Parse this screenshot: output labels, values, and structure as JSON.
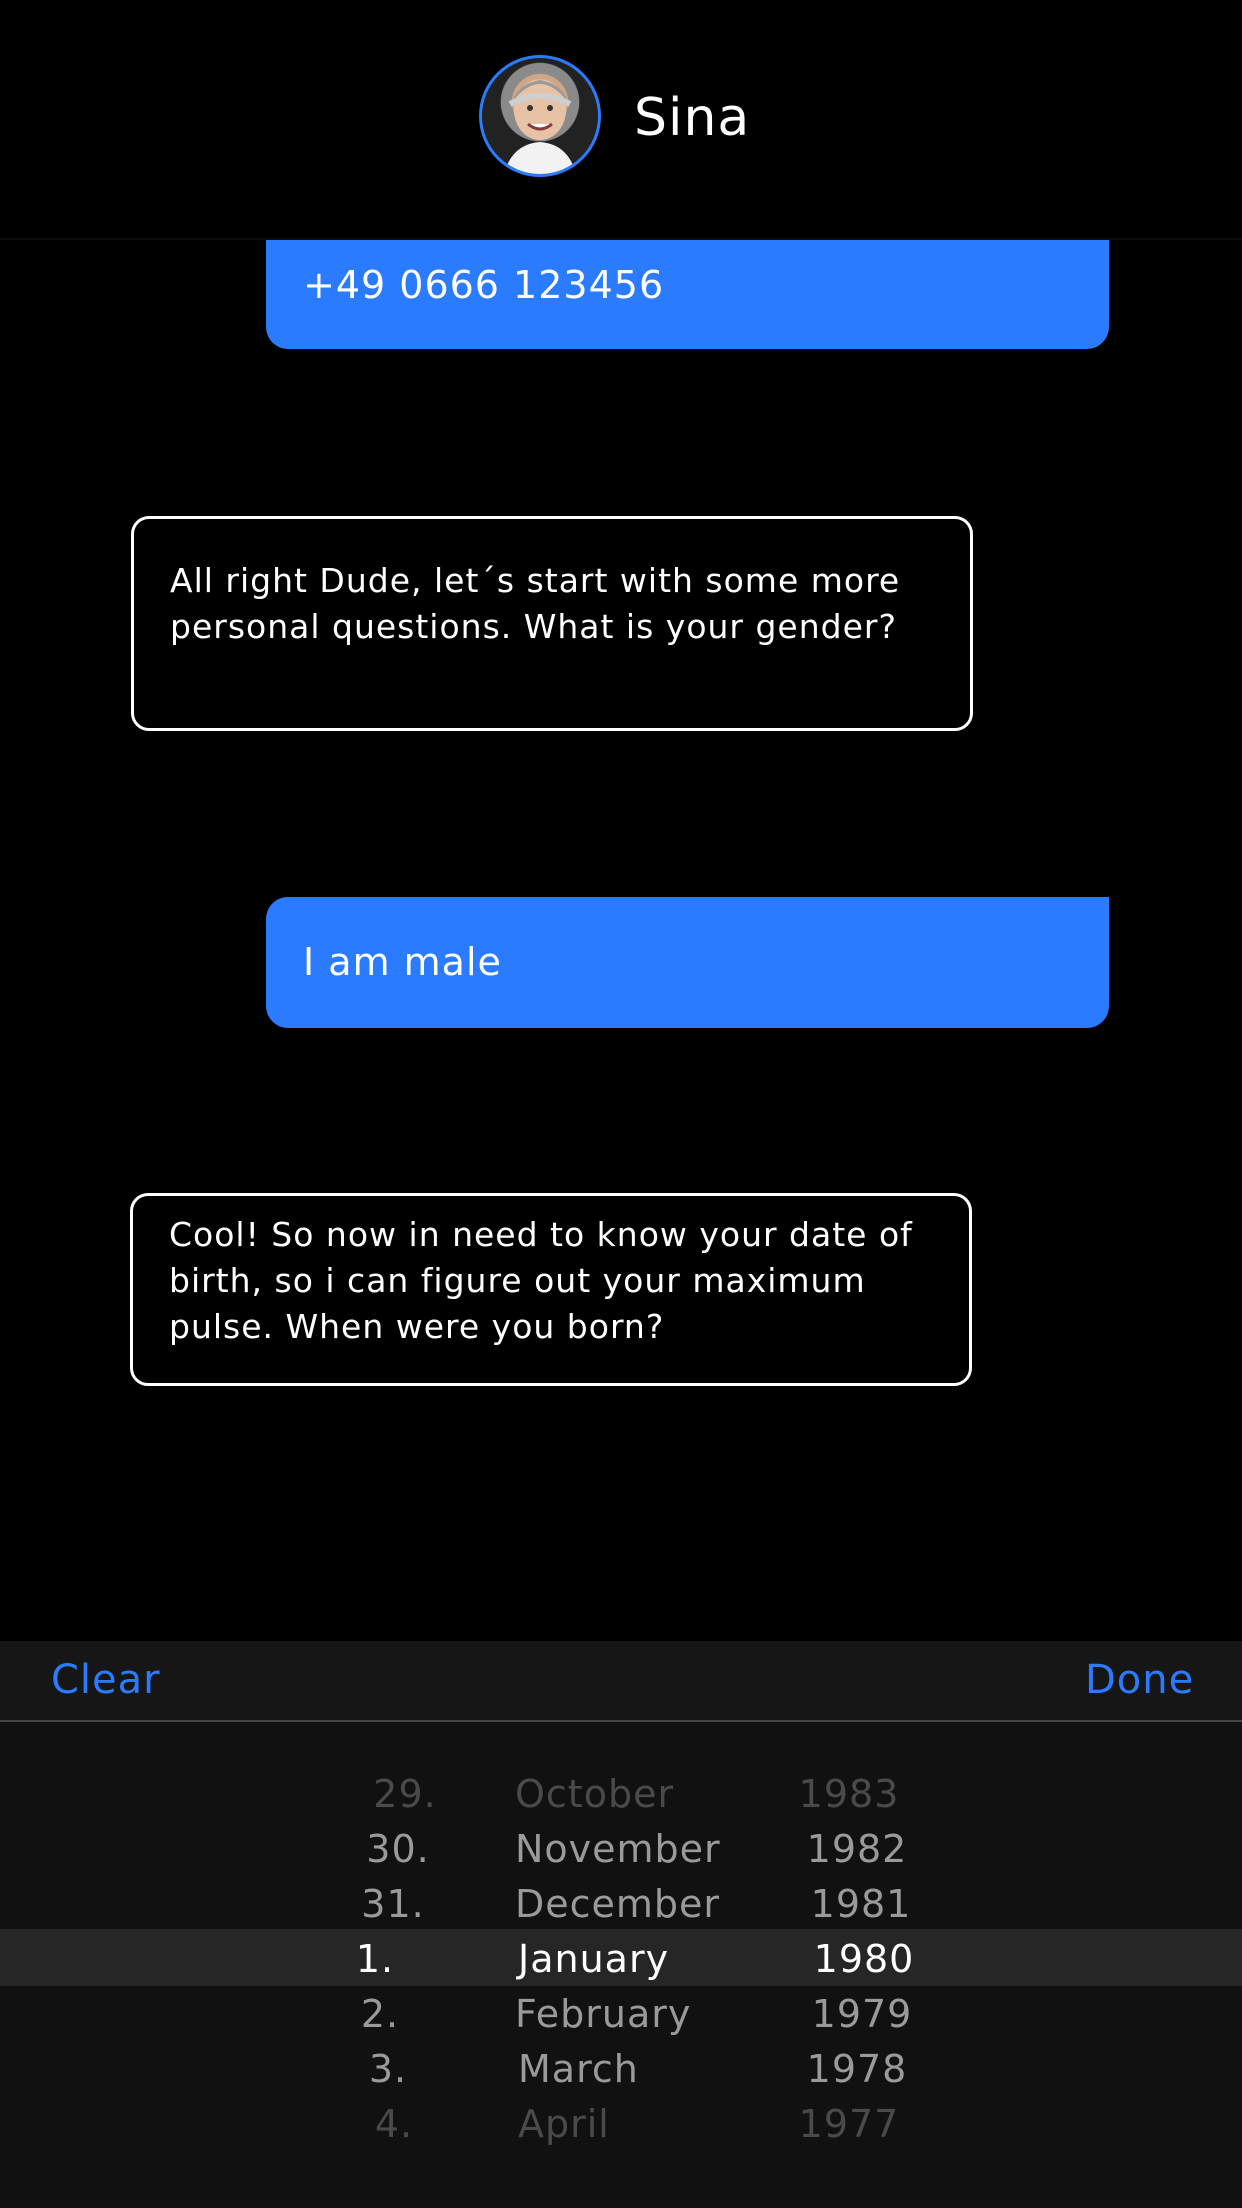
{
  "header": {
    "contact_name": "Sina",
    "avatar_icon": "contact-avatar-icon"
  },
  "messages": [
    {
      "direction": "outgoing",
      "text": "+49 0666 123456"
    },
    {
      "direction": "incoming",
      "text": "All right Dude, let´s start with some more personal questions. What is your gender?"
    },
    {
      "direction": "outgoing",
      "text": "I am male"
    },
    {
      "direction": "incoming",
      "text": "Cool! So now in need to know your date of birth, so i can figure out your maximum pulse. When were you born?"
    }
  ],
  "toolbar": {
    "clear_label": "Clear",
    "done_label": "Done"
  },
  "picker": {
    "days": [
      "29.",
      "30.",
      "31.",
      "1.",
      "2.",
      "3.",
      "4."
    ],
    "months": [
      "October",
      "November",
      "December",
      "January",
      "February",
      "March",
      "April"
    ],
    "years": [
      "1983",
      "1982",
      "1981",
      "1980",
      "1979",
      "1978",
      "1977"
    ],
    "selected": {
      "day": "1.",
      "month": "January",
      "year": "1980"
    }
  },
  "colors": {
    "accent": "#2b7bff",
    "background": "#000000",
    "picker_background": "#111111"
  }
}
